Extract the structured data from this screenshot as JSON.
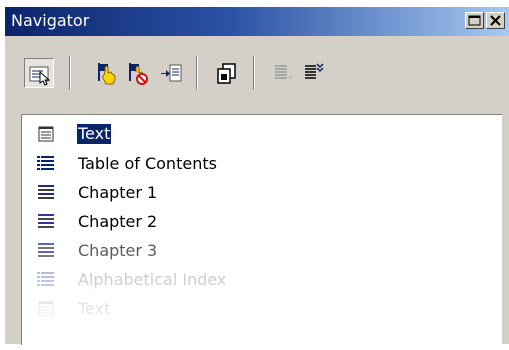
{
  "window": {
    "title": "Navigator"
  },
  "titlebar_buttons": [
    {
      "name": "restore-icon"
    },
    {
      "name": "close-icon"
    }
  ],
  "toolbar": [
    {
      "icon": "navigator-toggle-icon",
      "active": true
    },
    {
      "icon": "hand-pointer-icon"
    },
    {
      "icon": "hand-no-icon"
    },
    {
      "icon": "insert-arrow-icon"
    },
    {
      "icon": "copy-icon"
    },
    {
      "icon": "list-disabled-icon",
      "disabled": true
    },
    {
      "icon": "list-expand-icon"
    }
  ],
  "colors": {
    "titlebar_start": "#0a246a",
    "titlebar_end": "#a6caf0",
    "selection": "#0a246a",
    "face": "#d4d0c8"
  },
  "items": [
    {
      "label": "Text",
      "icon": "text-icon",
      "selected": true
    },
    {
      "label": "Table of Contents",
      "icon": "table-of-contents-icon"
    },
    {
      "label": "Chapter 1",
      "icon": "chapter-icon"
    },
    {
      "label": "Chapter 2",
      "icon": "chapter-icon"
    },
    {
      "label": "Chapter 3",
      "icon": "chapter-icon"
    },
    {
      "label": "Alphabetical Index",
      "icon": "index-icon"
    },
    {
      "label": "Text",
      "icon": "text-icon"
    }
  ]
}
